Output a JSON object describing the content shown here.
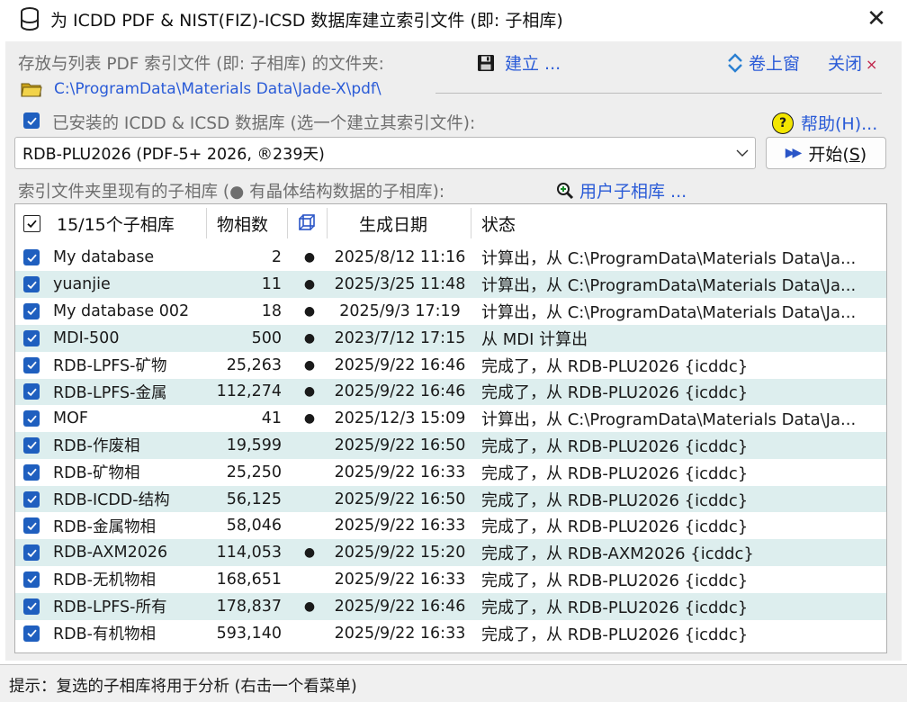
{
  "window": {
    "title": "为 ICDD PDF & NIST(FIZ)-ICSD 数据库建立索引文件 (即: 子相库)",
    "close_symbol": "✕"
  },
  "folder_row": {
    "label": "存放与列表 PDF 索引文件 (即: 子相库) 的文件夹:",
    "build_label": "建立 ...",
    "rollup_label": "卷上窗",
    "close_label": "关闭",
    "close_x": "×",
    "path": "C:\\ProgramData\\Materials Data\\Jade-X\\pdf\\"
  },
  "installed": {
    "checked": true,
    "label": "已安装的 ICDD & ICSD 数据库 (选一个建立其索引文件):",
    "help_label": "帮助(H)...",
    "help_icon_char": "?"
  },
  "database_select": {
    "value": "RDB-PLU2026 (PDF-5+ 2026, ®239天)",
    "start_label_prefix": "开始(",
    "start_label_key": "S",
    "start_label_suffix": ")",
    "start_arrows": "▶▶"
  },
  "index_section": {
    "label": "索引文件夹里现有的子相库 (● 有晶体结构数据的子相库):",
    "user_link": "用户子相库 ..."
  },
  "table": {
    "headers": {
      "name": "15/15个子相库",
      "count": "物相数",
      "date": "生成日期",
      "status": "状态"
    },
    "rows": [
      {
        "name": "My database",
        "count": "2",
        "dot": "●",
        "date": "2025/8/12 11:16",
        "status": "计算出，从 C:\\ProgramData\\Materials Data\\Ja..."
      },
      {
        "name": "yuanjie",
        "count": "11",
        "dot": "●",
        "date": "2025/3/25 11:48",
        "status": "计算出，从 C:\\ProgramData\\Materials Data\\Ja..."
      },
      {
        "name": "My database 002",
        "count": "18",
        "dot": "●",
        "date": "2025/9/3 17:19",
        "status": "计算出，从 C:\\ProgramData\\Materials Data\\Ja..."
      },
      {
        "name": "MDI-500",
        "count": "500",
        "dot": "●",
        "date": "2023/7/12 17:15",
        "status": "从 MDI 计算出"
      },
      {
        "name": "RDB-LPFS-矿物",
        "count": "25,263",
        "dot": "●",
        "date": "2025/9/22 16:46",
        "status": "完成了，从 RDB-PLU2026 {icddc}"
      },
      {
        "name": "RDB-LPFS-金属",
        "count": "112,274",
        "dot": "●",
        "date": "2025/9/22 16:46",
        "status": "完成了，从 RDB-PLU2026 {icddc}"
      },
      {
        "name": "MOF",
        "count": "41",
        "dot": "●",
        "date": "2025/12/3 15:09",
        "status": "计算出，从 C:\\ProgramData\\Materials Data\\Ja..."
      },
      {
        "name": "RDB-作废相",
        "count": "19,599",
        "dot": "",
        "date": "2025/9/22 16:50",
        "status": "完成了，从 RDB-PLU2026 {icddc}"
      },
      {
        "name": "RDB-矿物相",
        "count": "25,250",
        "dot": "",
        "date": "2025/9/22 16:33",
        "status": "完成了，从 RDB-PLU2026 {icddc}"
      },
      {
        "name": "RDB-ICDD-结构",
        "count": "56,125",
        "dot": "",
        "date": "2025/9/22 16:50",
        "status": "完成了，从 RDB-PLU2026 {icddc}"
      },
      {
        "name": "RDB-金属物相",
        "count": "58,046",
        "dot": "",
        "date": "2025/9/22 16:33",
        "status": "完成了，从 RDB-PLU2026 {icddc}"
      },
      {
        "name": "RDB-AXM2026",
        "count": "114,053",
        "dot": "●",
        "date": "2025/9/22 15:20",
        "status": "完成了，从 RDB-AXM2026 {icddc}"
      },
      {
        "name": "RDB-无机物相",
        "count": "168,651",
        "dot": "",
        "date": "2025/9/22 16:33",
        "status": "完成了，从 RDB-PLU2026 {icddc}"
      },
      {
        "name": "RDB-LPFS-所有",
        "count": "178,837",
        "dot": "●",
        "date": "2025/9/22 16:46",
        "status": "完成了，从 RDB-PLU2026 {icddc}"
      },
      {
        "name": "RDB-有机物相",
        "count": "593,140",
        "dot": "",
        "date": "2025/9/22 16:33",
        "status": "完成了，从 RDB-PLU2026 {icddc}"
      }
    ]
  },
  "statusbar": {
    "text": "提示：复选的子相库将用于分析 (右击一个看菜单)"
  },
  "colors": {
    "link": "#2a5bd7",
    "checkbox": "#1f5fbf",
    "alt_row": "#ddeeee",
    "client_bg": "#eeeeee"
  }
}
